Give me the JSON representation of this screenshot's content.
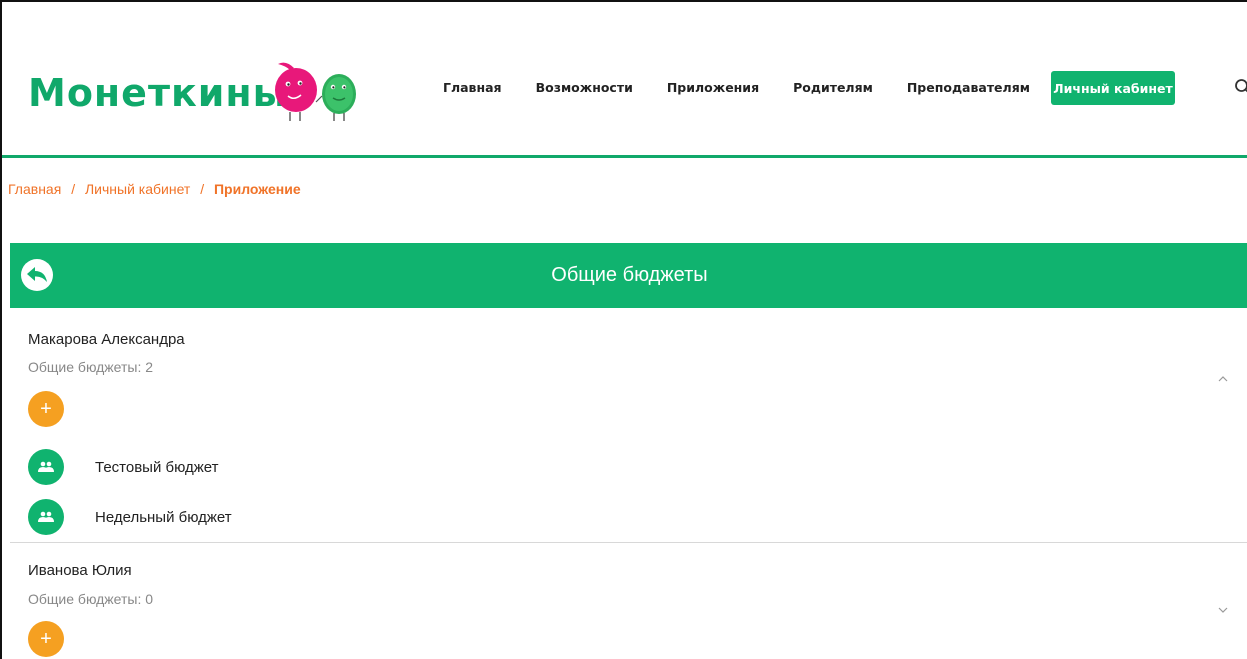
{
  "brand": {
    "name": "Монеткины"
  },
  "nav": {
    "items": [
      "Главная",
      "Возможности",
      "Приложения",
      "Родителям",
      "Преподавателям"
    ],
    "cta": "Личный кабинет"
  },
  "breadcrumb": {
    "home": "Главная",
    "separator": "/",
    "cabinet": "Личный кабинет",
    "current": "Приложение"
  },
  "page": {
    "title": "Общие бюджеты"
  },
  "members": [
    {
      "name": "Макарова Александра",
      "count_text": "Общие бюджеты: 2",
      "add_label": "+",
      "expanded": true,
      "budgets": [
        "Тестовый бюджет",
        "Недельный бюджет"
      ]
    },
    {
      "name": "Иванова Юлия",
      "count_text": "Общие бюджеты: 0",
      "add_label": "+",
      "expanded": false,
      "budgets": []
    }
  ],
  "colors": {
    "brand_green": "#10b36f",
    "accent_orange": "#f5a021",
    "breadcrumb_orange": "#f07328",
    "logo_pink": "#e8187a"
  },
  "icons": {
    "back": "back-arrow-icon",
    "add": "plus-icon",
    "budget": "group-icon",
    "expand": "chevron-up-icon",
    "collapse": "chevron-down-icon",
    "search": "search-icon"
  }
}
